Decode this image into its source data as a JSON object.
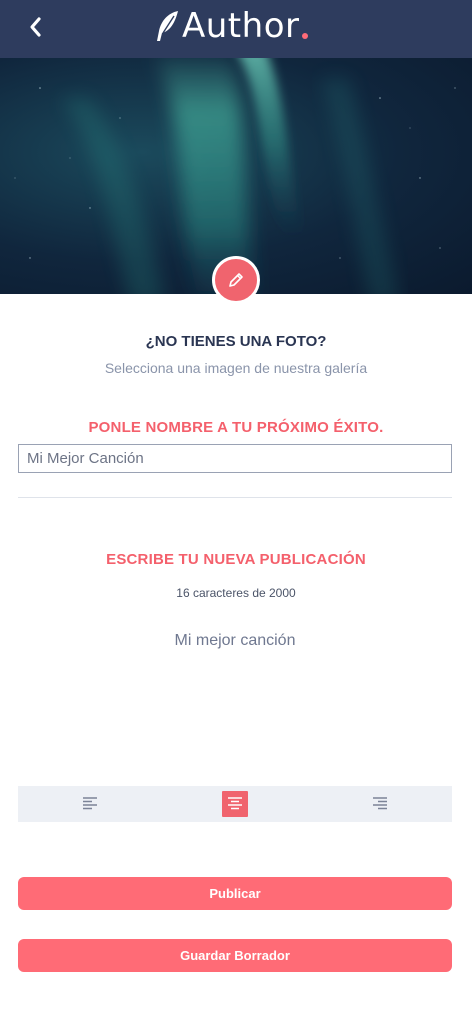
{
  "header": {
    "brand": "Author",
    "brand_accent": "#ff6b78",
    "background": "#2e3c5e",
    "back_icon": "chevron-left-icon"
  },
  "photo": {
    "edit_icon": "pencil-icon",
    "no_photo_title": "¿NO TIENES UNA FOTO?",
    "gallery_link": "Selecciona una imagen de nuestra galería"
  },
  "title_section": {
    "heading": "PONLE NOMBRE A TU PRÓXIMO ÉXITO.",
    "input_value": "Mi Mejor Canción"
  },
  "post_section": {
    "heading": "ESCRIBE TU NUEVA PUBLICACIÓN",
    "char_count": "16 caracteres de 2000",
    "body": "Mi mejor canción"
  },
  "alignment": {
    "options": [
      "align-left-icon",
      "align-center-icon",
      "align-right-icon"
    ],
    "selected": "align-center-icon"
  },
  "actions": {
    "publish_label": "Publicar",
    "draft_label": "Guardar Borrador"
  },
  "colors": {
    "accent": "#f4606c",
    "button": "#ff6b76",
    "dark": "#2a3552"
  }
}
